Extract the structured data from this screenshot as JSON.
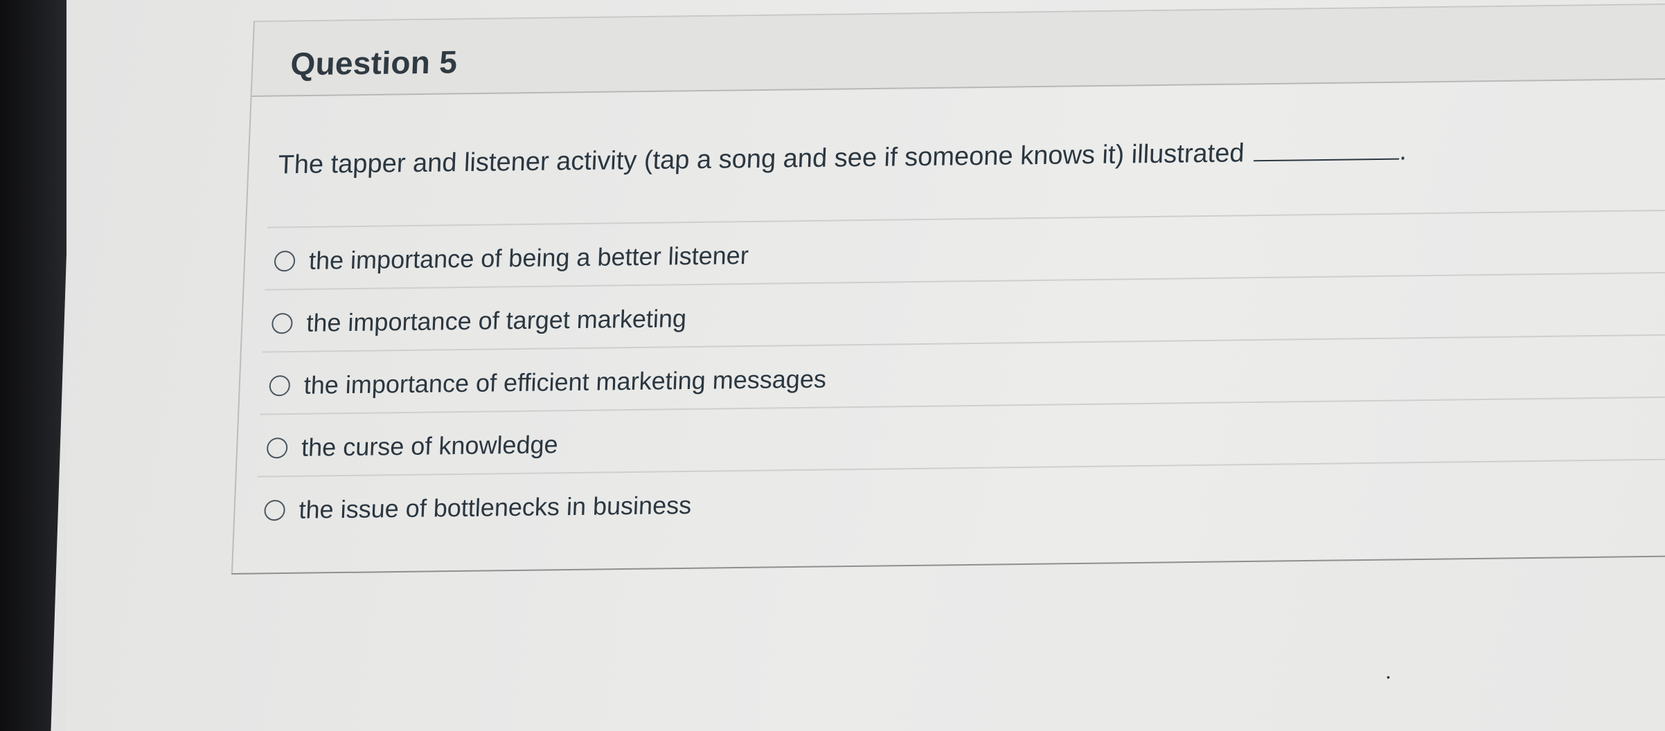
{
  "question": {
    "title": "Question 5",
    "text": "The tapper and listener activity (tap a song and see if someone knows it) illustrated",
    "blank_suffix": "."
  },
  "answers": [
    {
      "label": "the importance of being a better listener",
      "selected": false
    },
    {
      "label": "the importance of target marketing",
      "selected": false
    },
    {
      "label": "the importance of efficient marketing messages",
      "selected": false
    },
    {
      "label": "the curse of knowledge",
      "selected": false
    },
    {
      "label": "the issue of bottlenecks in business",
      "selected": false
    }
  ]
}
